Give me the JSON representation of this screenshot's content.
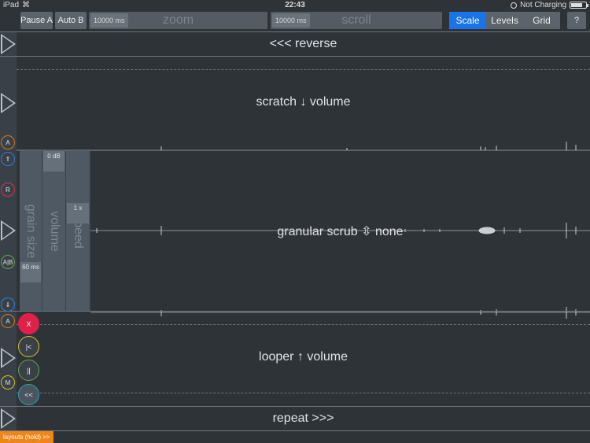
{
  "status": {
    "device": "iPad",
    "time": "22:43",
    "charging": "Not Charging",
    "battery_level": 0.75
  },
  "toolbar": {
    "pause": "Pause A",
    "auto": "Auto B",
    "zoom_value": "10000 ms",
    "zoom_label": "zoom",
    "scroll_value": "10000 ms",
    "scroll_label": "scroll",
    "tabs": [
      {
        "label": "Scale",
        "active": true
      },
      {
        "label": "Levels",
        "active": false
      },
      {
        "label": "Grid",
        "active": false
      }
    ],
    "help": "?"
  },
  "rows": {
    "reverse": "<<< reverse",
    "scratch": "scratch ↓ volume",
    "granular": "granular scrub ⇳ none",
    "looper": "looper ↑ volume",
    "repeat": "repeat >>>"
  },
  "side_buttons": {
    "a1": "A",
    "up": "⇑",
    "r": "R",
    "ab": "A|B",
    "down": "⇓",
    "a2": "A",
    "m": "M"
  },
  "granular": {
    "grain_label": "grain size",
    "grain_value": "60 ms",
    "volume_label": "volume",
    "volume_value": "0 dB",
    "speed_label": "speed",
    "speed_value": "1 x"
  },
  "looper": {
    "x": "X",
    "start": "|<",
    "pause": "||",
    "back": "<<"
  },
  "footer": {
    "layouts": "layouts (hold) >>"
  },
  "colors": {
    "accent": "#1a73e8",
    "orange": "#f08519",
    "red": "#e0204a",
    "yellow": "#d9c22a",
    "green": "#63a64b",
    "blue": "#2f7fd8"
  }
}
